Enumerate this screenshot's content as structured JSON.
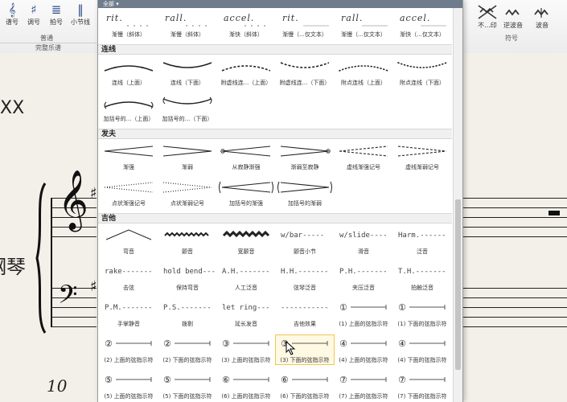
{
  "app": {
    "ribbon_left": [
      {
        "label": "谱号",
        "icon": "clef-icon"
      },
      {
        "label": "调号",
        "icon": "key-signature-icon"
      },
      {
        "label": "拍号",
        "icon": "time-signature-icon"
      },
      {
        "label": "小节线",
        "icon": "barline-icon"
      }
    ],
    "group_left_label": "普通",
    "group_left_bar": "完整乐谱",
    "ribbon_right": [
      {
        "label": "不...印",
        "icon": "no-print-icon"
      },
      {
        "label": "逆波音",
        "icon": "inverted-mordent-icon"
      },
      {
        "label": "波音",
        "icon": "mordent-icon"
      }
    ],
    "group_right_label": "符号",
    "score_text_xx": "XX",
    "instrument_name": "钢琴",
    "measure_number": "10"
  },
  "palette": {
    "header_label": "全部 ▾",
    "rows_top": [
      {
        "text": "rit.",
        "label": "渐慢（斜体）"
      },
      {
        "text": "rall.",
        "label": "渐慢（斜体）"
      },
      {
        "text": "accel.",
        "label": "渐快（斜体）"
      },
      {
        "text": "rit.",
        "label": "渐慢（...仅文本）"
      },
      {
        "text": "rall.",
        "label": "渐慢（...仅文本）"
      },
      {
        "text": "accel.",
        "label": "渐快（...仅文本）"
      }
    ],
    "section_slur": "连线",
    "slurs": [
      {
        "label": "连线（上面）"
      },
      {
        "label": "连线（下面）"
      },
      {
        "label": "附虚线连...（上面）"
      },
      {
        "label": "附虚线连...（下面）"
      },
      {
        "label": "附点连线（上面）"
      },
      {
        "label": "附点连线（下面）"
      },
      {
        "label": "加括号的...（上面）"
      },
      {
        "label": "加括号的...（下面）"
      }
    ],
    "section_dyn": "发夫",
    "hairpins": [
      {
        "label": "渐强"
      },
      {
        "label": "渐弱"
      },
      {
        "label": "从寂静渐强"
      },
      {
        "label": "渐弱至寂静"
      },
      {
        "label": "虚线渐强记号"
      },
      {
        "label": "虚线渐弱记号"
      },
      {
        "label": "点状渐强记号"
      },
      {
        "label": "点状渐弱记号"
      },
      {
        "label": "加括号的渐强"
      },
      {
        "label": "加括号的渐弱"
      }
    ],
    "section_guitar": "吉他",
    "guitar": [
      {
        "text": "",
        "label": "弯音"
      },
      {
        "text": "",
        "label": "颤音"
      },
      {
        "text": "",
        "label": "宽颤音"
      },
      {
        "text": "w/bar-----",
        "label": "颤音小节"
      },
      {
        "text": "w/slide----",
        "label": "滑音"
      },
      {
        "text": "Harm.------",
        "label": "泛音"
      },
      {
        "text": "rake-------",
        "label": "击弦"
      },
      {
        "text": "hold bend---",
        "label": "保持弯音"
      },
      {
        "text": "A.H.-------",
        "label": "人工泛音"
      },
      {
        "text": "H.H.-------",
        "label": "弦琴泛音"
      },
      {
        "text": "P.H.-------",
        "label": "夹压泛音"
      },
      {
        "text": "T.H.-------",
        "label": "拍触泛音"
      },
      {
        "text": "P.M.-------",
        "label": "手掌静音"
      },
      {
        "text": "P.S.-------",
        "label": "拨剔"
      },
      {
        "text": "let ring---",
        "label": "延长发音"
      },
      {
        "text": "-----------",
        "label": "吉他效果"
      },
      {
        "text": "①",
        "label": "(1) 上面的弦指示符"
      },
      {
        "text": "①",
        "label": "(1) 下面的弦指示符"
      },
      {
        "text": "②",
        "label": "(2) 上面的弦指示符"
      },
      {
        "text": "②",
        "label": "(2) 下面的弦指示符"
      },
      {
        "text": "③",
        "label": "(3) 上面的弦指示符"
      },
      {
        "text": "③",
        "label": "(3) 下面的弦指示符"
      },
      {
        "text": "④",
        "label": "(4) 上面的弦指示符"
      },
      {
        "text": "④",
        "label": "(4) 下面的弦指示符"
      },
      {
        "text": "⑤",
        "label": "(5) 上面的弦指示符"
      },
      {
        "text": "⑤",
        "label": "(5) 下面的弦指示符"
      },
      {
        "text": "⑥",
        "label": "(6) 上面的弦指示符"
      },
      {
        "text": "⑥",
        "label": "(6) 下面的弦指示符"
      },
      {
        "text": "⑦",
        "label": "(7) 上面的弦指示符"
      },
      {
        "text": "⑦",
        "label": "(7) 下面的弦指示符"
      }
    ]
  }
}
